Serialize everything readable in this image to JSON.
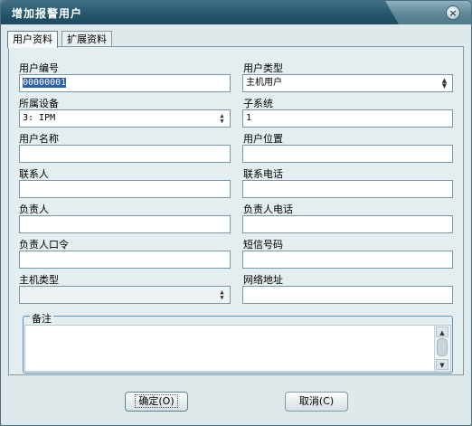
{
  "window": {
    "title": "增加报警用户",
    "close_icon": "close-icon"
  },
  "tabs": [
    {
      "label": "用户资料",
      "active": true
    },
    {
      "label": "扩展资料",
      "active": false
    }
  ],
  "form": {
    "user_id": {
      "label": "用户编号",
      "value": "00000001"
    },
    "user_type": {
      "label": "用户类型",
      "value": "主机用户"
    },
    "device": {
      "label": "所属设备",
      "value": "3: IPM"
    },
    "subsystem": {
      "label": "子系统",
      "value": "1"
    },
    "user_name": {
      "label": "用户名称",
      "value": ""
    },
    "user_location": {
      "label": "用户位置",
      "value": ""
    },
    "contact": {
      "label": "联系人",
      "value": ""
    },
    "contact_phone": {
      "label": "联系电话",
      "value": ""
    },
    "manager": {
      "label": "负责人",
      "value": ""
    },
    "manager_phone": {
      "label": "负责人电话",
      "value": ""
    },
    "manager_password": {
      "label": "负责人口令",
      "value": ""
    },
    "sms_number": {
      "label": "短信号码",
      "value": ""
    },
    "host_type": {
      "label": "主机类型",
      "value": ""
    },
    "network_address": {
      "label": "网络地址",
      "value": ""
    },
    "remarks": {
      "label": "备注",
      "value": ""
    }
  },
  "buttons": {
    "ok": "确定(O)",
    "cancel": "取消(C)"
  },
  "colors": {
    "title_bar": "#245468",
    "background": "#dfe9ec",
    "selection": "#2f5fa8"
  }
}
